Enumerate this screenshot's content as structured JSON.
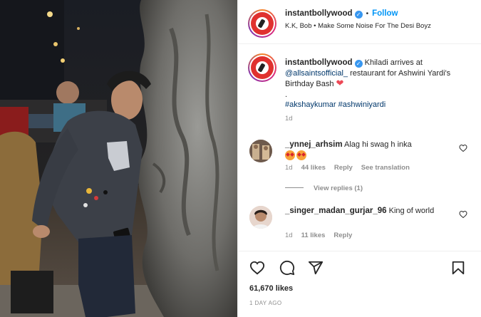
{
  "post": {
    "account": "instantbollywood",
    "follow_label": "Follow",
    "separator": "•",
    "audio": "K.K, Bob • Make Some Noise For The Desi Boyz"
  },
  "caption": {
    "username": "instantbollywood",
    "text_before": "Khiladi arrives at",
    "mention": "@allsaintsofficial_",
    "text_after": "restaurant for Ashwini Yardi's Birthday Bash",
    "dot": ".",
    "hashtags": "#akshaykumar #ashwiniyardi",
    "time": "1d"
  },
  "comments": [
    {
      "username": "_ynnej_arhsim",
      "text": "Alag hi swag h inka",
      "time": "1d",
      "likes": "44 likes",
      "reply": "Reply",
      "translate": "See translation",
      "view_replies": "View replies (1)"
    },
    {
      "username": "_singer_madan_gurjar_96",
      "text": "King of world",
      "time": "1d",
      "likes": "11 likes",
      "reply": "Reply"
    }
  ],
  "footer": {
    "likes": "61,670 likes",
    "posted": "1 DAY AGO"
  },
  "icons": [
    "verified-badge",
    "heart-icon",
    "comment-icon",
    "share-icon",
    "save-icon",
    "like-comment-icon"
  ],
  "colors": {
    "accent": "#0095f6",
    "heart": "#ed4956",
    "muted": "#8e8e8e"
  }
}
